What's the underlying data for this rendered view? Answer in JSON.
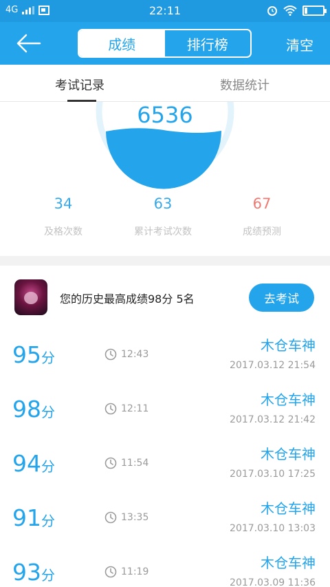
{
  "status_bar": {
    "network": "4G",
    "time": "22:11"
  },
  "nav": {
    "back_icon": "arrow-left-icon",
    "tabs": [
      {
        "label": "成绩",
        "active": true
      },
      {
        "label": "排行榜",
        "active": false
      }
    ],
    "clear_label": "清空"
  },
  "subtabs": [
    {
      "label": "考试记录",
      "active": true
    },
    {
      "label": "数据统计",
      "active": false
    }
  ],
  "stats": {
    "total": "6536",
    "items": [
      {
        "value": "34",
        "label": "及格次数",
        "color": "#38a9e6"
      },
      {
        "value": "63",
        "label": "累计考试次数",
        "color": "#38a9e6"
      },
      {
        "value": "67",
        "label": "成绩预测",
        "color": "#ef7a72"
      }
    ]
  },
  "best": {
    "text": "您的历史最高成绩98分  5名",
    "button": "去考试"
  },
  "records": [
    {
      "score": "95",
      "unit": "分",
      "duration": "12:43",
      "name": "木仓车神",
      "date": "2017.03.12  21:54"
    },
    {
      "score": "98",
      "unit": "分",
      "duration": "12:11",
      "name": "木仓车神",
      "date": "2017.03.12  21:42"
    },
    {
      "score": "94",
      "unit": "分",
      "duration": "11:54",
      "name": "木仓车神",
      "date": "2017.03.10  17:25"
    },
    {
      "score": "91",
      "unit": "分",
      "duration": "13:35",
      "name": "木仓车神",
      "date": "2017.03.10  13:03"
    },
    {
      "score": "93",
      "unit": "分",
      "duration": "11:19",
      "name": "木仓车神",
      "date": "2017.03.09  11:36"
    }
  ],
  "colors": {
    "accent": "#23a4eb",
    "status_bar": "#1f99e0",
    "prediction": "#ef7a72"
  }
}
